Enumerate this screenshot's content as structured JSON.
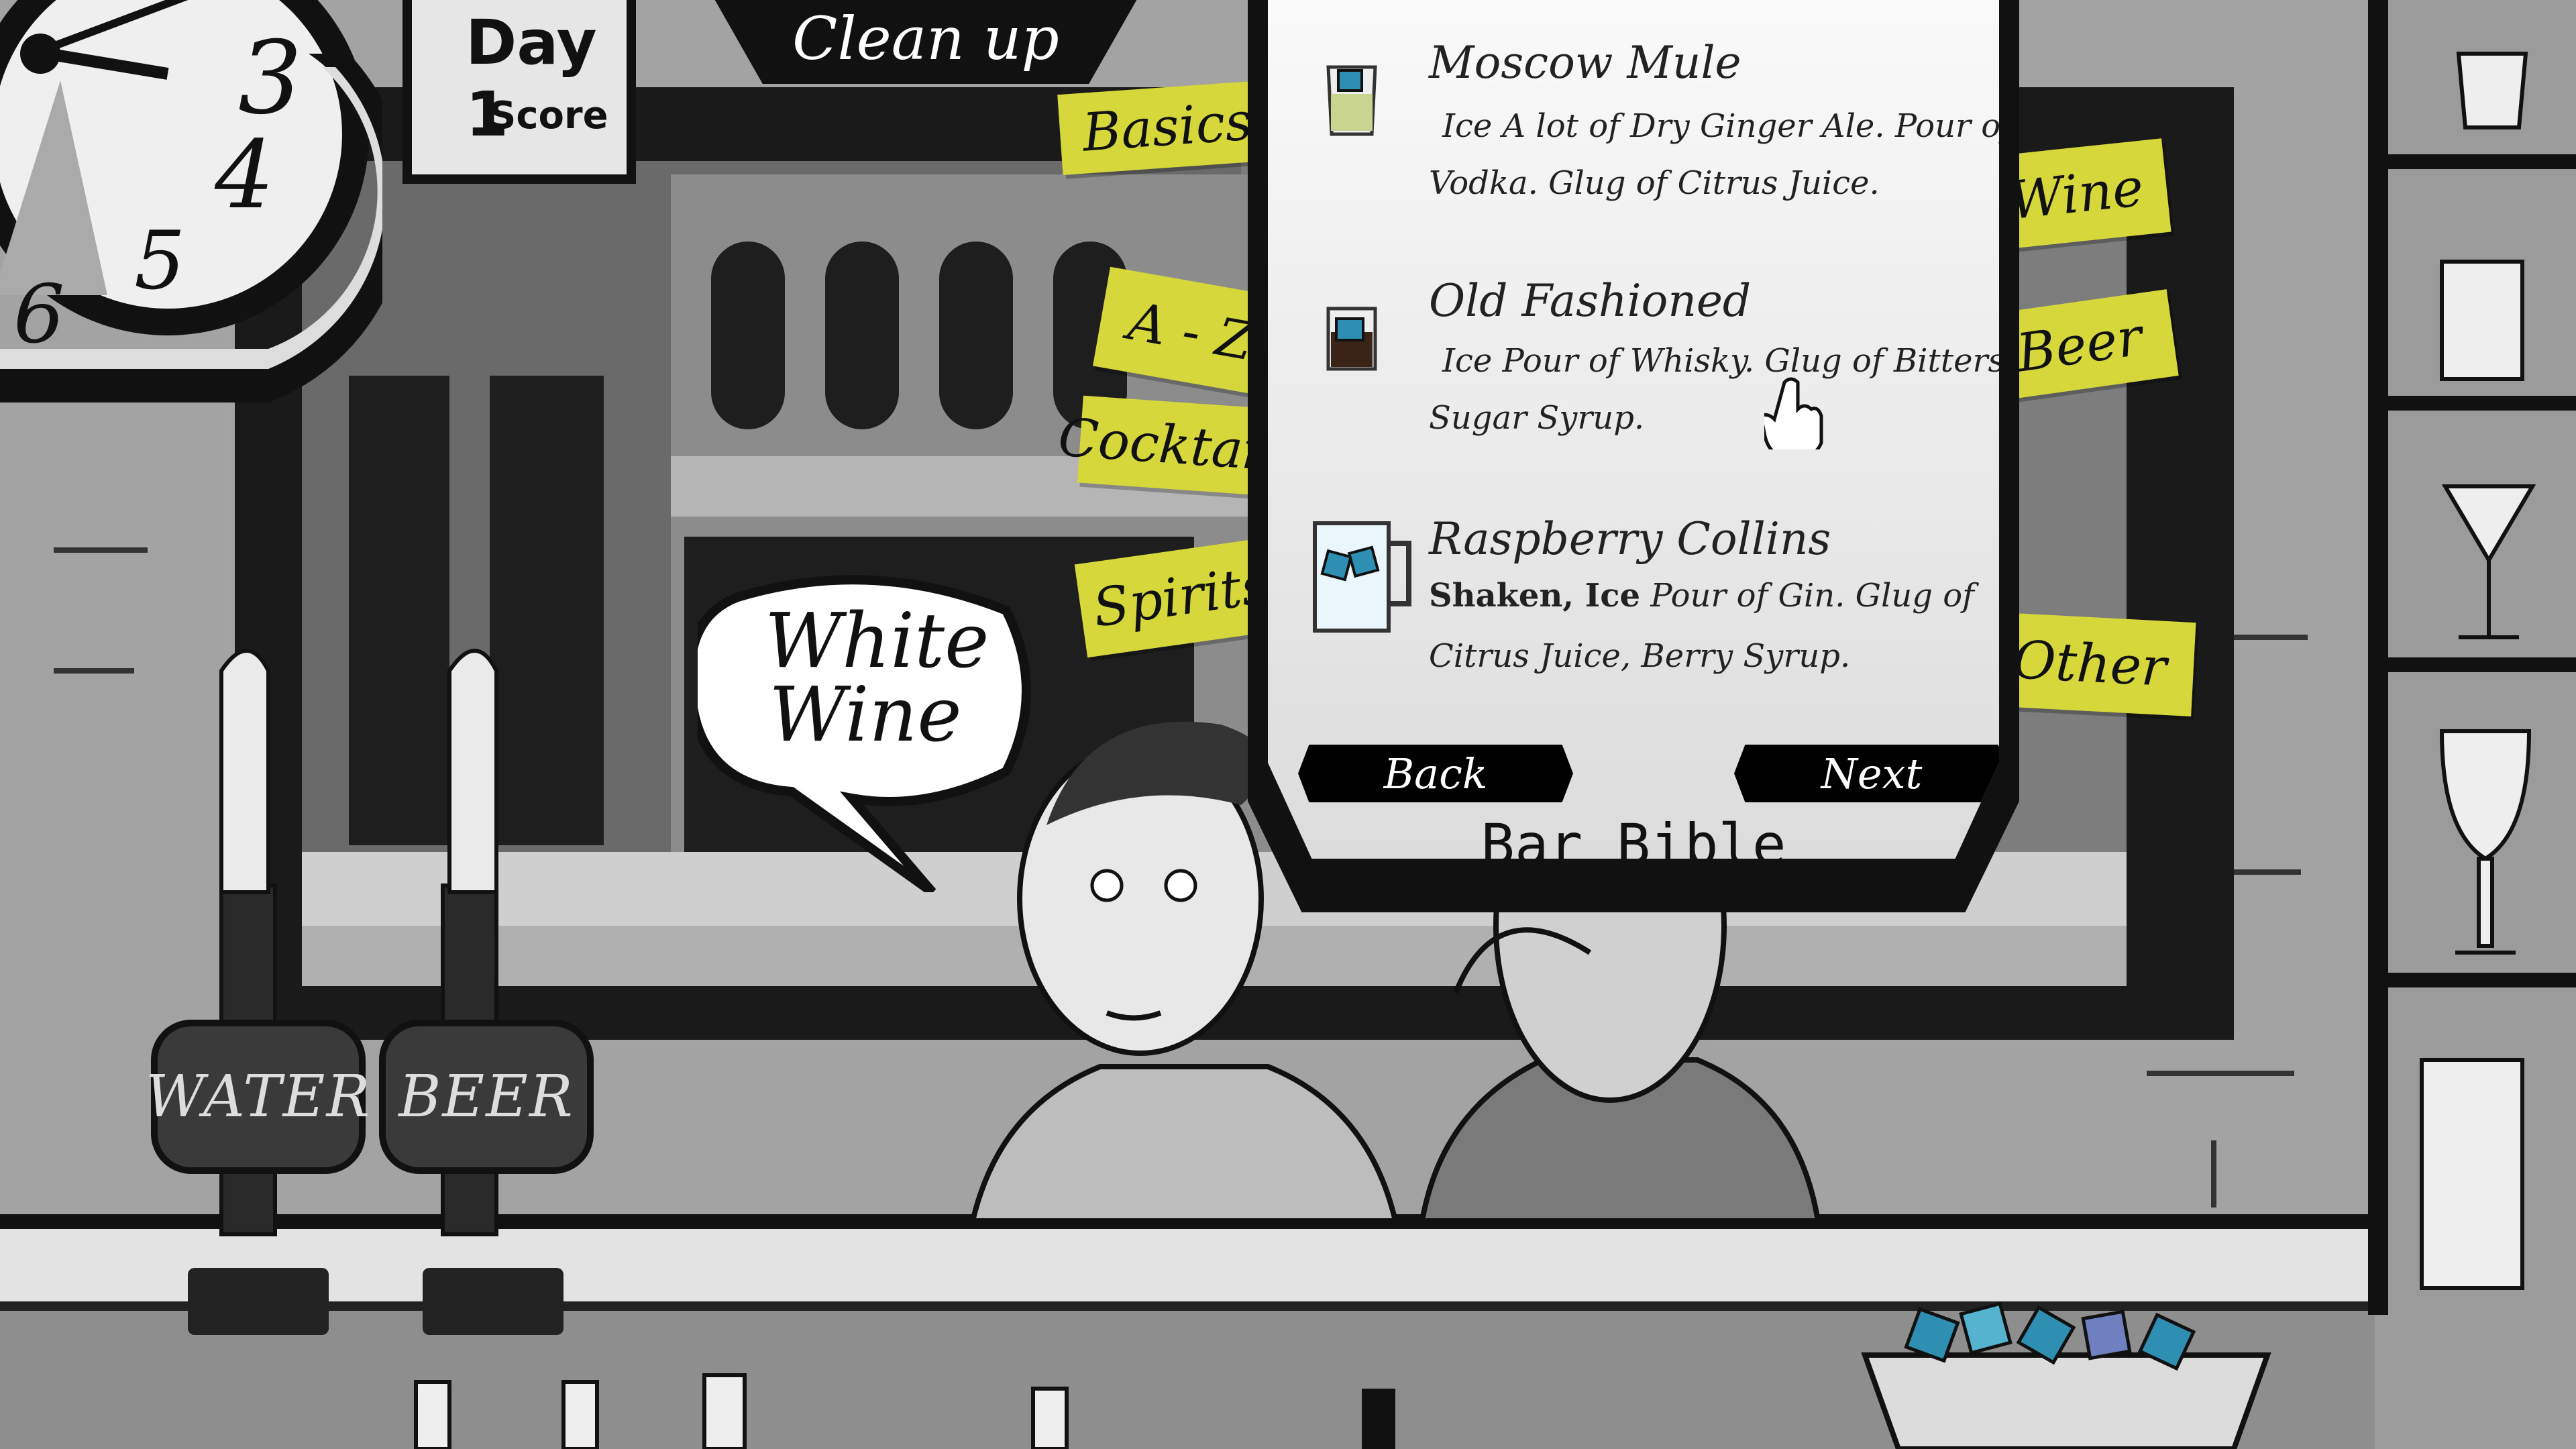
{
  "hud": {
    "day_label": "Day 1",
    "score_label": "Score",
    "clock_numbers": [
      "3",
      "4",
      "5",
      "6"
    ]
  },
  "banner": {
    "clean_up": "Clean up"
  },
  "speech": {
    "line1": "White",
    "line2": "Wine"
  },
  "book": {
    "title": "Bar Bible",
    "back_label": "Back",
    "next_label": "Next",
    "tabs_left": [
      "Basics",
      "A - Z",
      "Cocktails",
      "Spirits"
    ],
    "tabs_right": [
      "Wine",
      "Beer",
      "Other"
    ],
    "recipes": [
      {
        "name": "Moscow Mule",
        "line1_rest": "Ice  A lot of Dry Ginger Ale. Pour of",
        "line2": "Vodka. Glug of Citrus Juice.",
        "glass_icon": "moscow-mule-glass-icon"
      },
      {
        "name": "Old Fashioned",
        "line1_rest": "Ice  Pour of Whisky. Glug of Bitters.",
        "line2": "Sugar Syrup.",
        "glass_icon": "old-fashioned-glass-icon"
      },
      {
        "name": "Raspberry Collins",
        "line1_bold": "Shaken, Ice",
        "line1_rest": " Pour of Gin. Glug of",
        "line2": "Citrus Juice, Berry Syrup.",
        "glass_icon": "collins-mug-icon"
      }
    ]
  },
  "taps": {
    "water": "WATER",
    "beer": "BEER"
  },
  "colors": {
    "tab_yellow": "#d6d73a",
    "ice_blue": "#2f8fb3"
  }
}
